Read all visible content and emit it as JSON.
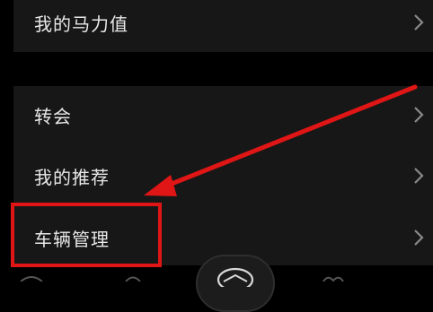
{
  "menu_top": {
    "item_mali": "我的马力值"
  },
  "menu_main": {
    "items": [
      {
        "label": "转会"
      },
      {
        "label": "我的推荐"
      },
      {
        "label": "车辆管理"
      }
    ]
  },
  "annotation": {
    "color": "#e01515",
    "highlighted_item": "车辆管理"
  },
  "icons": {
    "chevron": "chevron-right-icon",
    "tab_left": "chat-icon",
    "tab_left2": "discover-icon",
    "tab_center": "brand-logo-icon",
    "tab_right": "heart-icon"
  }
}
